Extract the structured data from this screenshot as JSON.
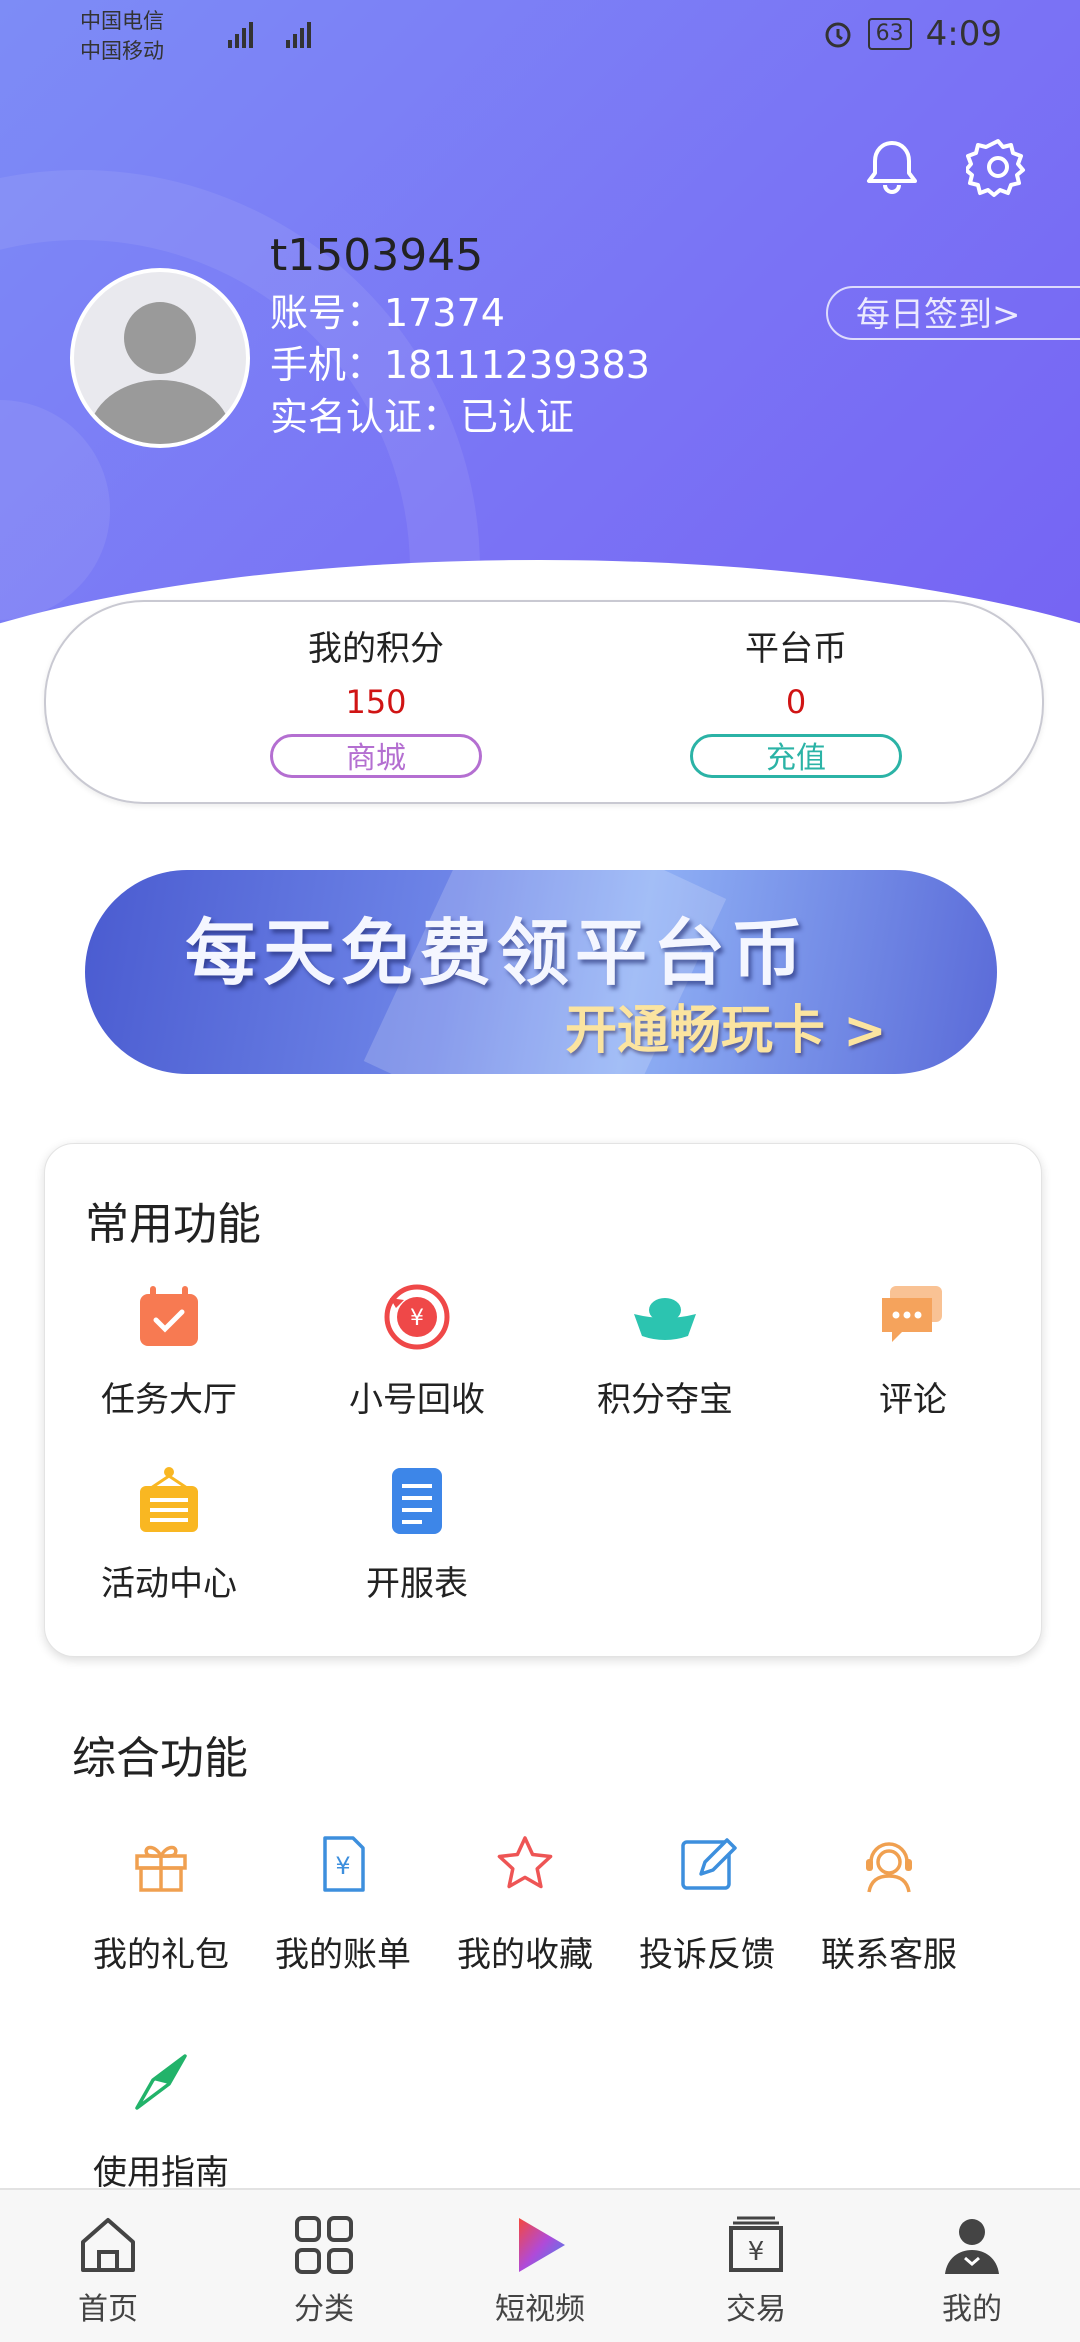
{
  "status_bar": {
    "carrier1": "中国电信",
    "carrier2": "中国移动",
    "battery": "63",
    "time": "4:09"
  },
  "profile": {
    "username": "t1503945",
    "account": "账号：17374",
    "phone": "手机：18111239383",
    "verification": "实名认证：已认证",
    "signin_label": "每日签到>"
  },
  "points": {
    "my_points_label": "我的积分",
    "my_points_value": "150",
    "mall_label": "商城",
    "coins_label": "平台币",
    "coins_value": "0",
    "recharge_label": "充值"
  },
  "banner": {
    "title": "每天免费领平台币",
    "subtitle": "开通畅玩卡 >"
  },
  "common_functions": {
    "title": "常用功能",
    "items": [
      {
        "label": "任务大厅",
        "icon": "calendar-check-icon",
        "color": "#f77a52"
      },
      {
        "label": "小号回收",
        "icon": "yuan-recycle-icon",
        "color": "#ef4848"
      },
      {
        "label": "积分夺宝",
        "icon": "gold-ingot-icon",
        "color": "#2cc4b0"
      },
      {
        "label": "评论",
        "icon": "comment-bubble-icon",
        "color": "#f5a35c"
      },
      {
        "label": "活动中心",
        "icon": "notice-board-icon",
        "color": "#f9b722"
      },
      {
        "label": "开服表",
        "icon": "document-list-icon",
        "color": "#3d86e8"
      }
    ]
  },
  "general_functions": {
    "title": "综合功能",
    "items": [
      {
        "label": "我的礼包",
        "icon": "gift-icon",
        "color": "#f0a050"
      },
      {
        "label": "我的账单",
        "icon": "bill-icon",
        "color": "#3d8fdd"
      },
      {
        "label": "我的收藏",
        "icon": "star-icon",
        "color": "#ee5555"
      },
      {
        "label": "投诉反馈",
        "icon": "edit-icon",
        "color": "#3d8fdd"
      },
      {
        "label": "联系客服",
        "icon": "headset-agent-icon",
        "color": "#f0a050"
      },
      {
        "label": "使用指南",
        "icon": "compass-icon",
        "color": "#22b36a"
      }
    ]
  },
  "tabbar": [
    {
      "label": "首页",
      "icon": "home-icon"
    },
    {
      "label": "分类",
      "icon": "grid-icon"
    },
    {
      "label": "短视频",
      "icon": "play-icon"
    },
    {
      "label": "交易",
      "icon": "trade-yuan-icon"
    },
    {
      "label": "我的",
      "icon": "user-icon"
    }
  ]
}
